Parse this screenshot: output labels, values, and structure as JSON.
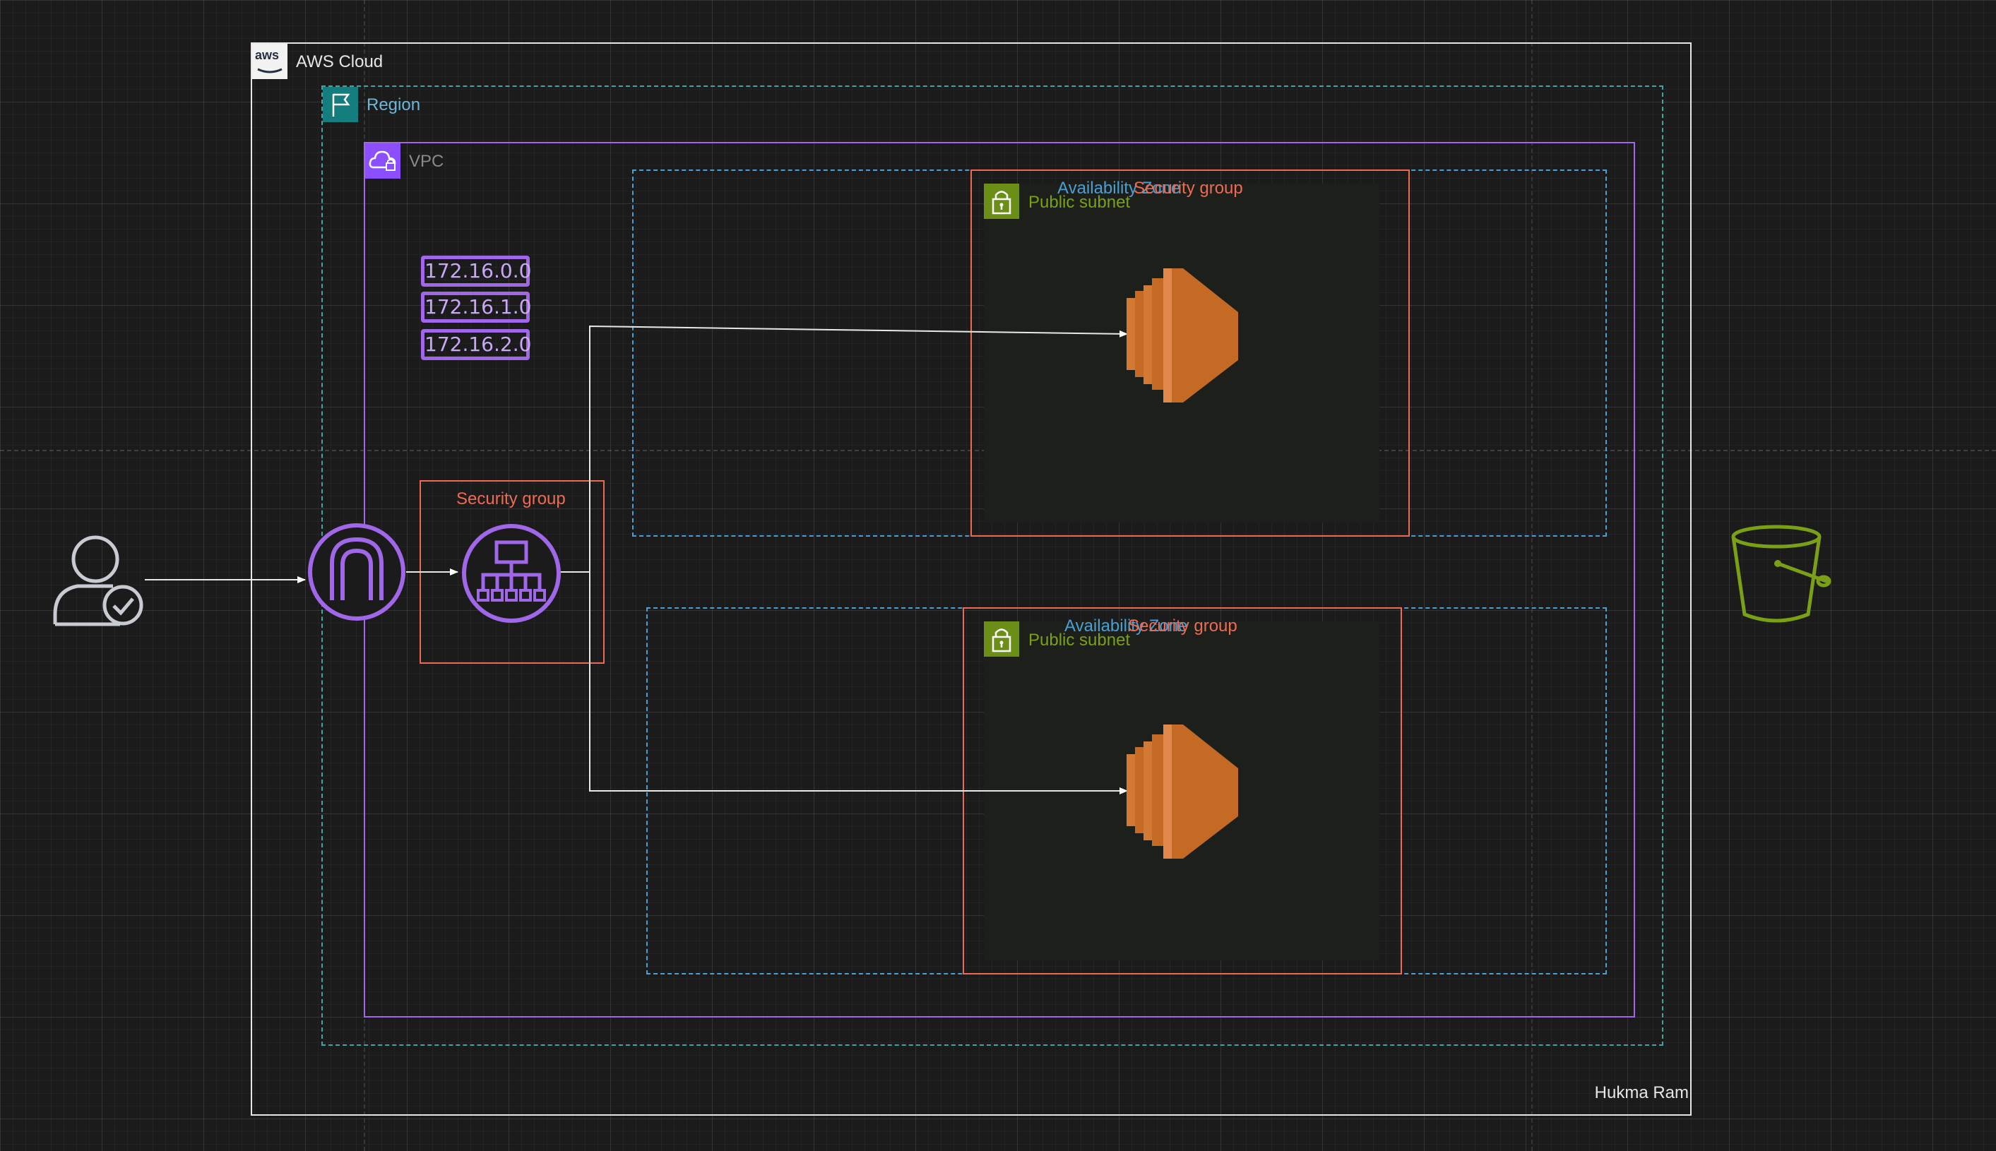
{
  "diagram": {
    "aws_cloud": {
      "label": "AWS Cloud",
      "logo_text": "aws"
    },
    "region": {
      "label": "Region"
    },
    "vpc": {
      "label": "VPC"
    },
    "route_cidrs": [
      "172.16.0.0",
      "172.16.1.0",
      "172.16.2.0"
    ],
    "alb_security_group": {
      "label": "Security group"
    },
    "zone_top": {
      "availability_zone_label": "Availability Zone",
      "security_group_label": "Security group",
      "subnet_label": "Public subnet"
    },
    "zone_bottom": {
      "availability_zone_label": "Availability Zone",
      "security_group_label": "Security group",
      "subnet_label": "Public subnet"
    },
    "author": "Hukma Ram",
    "icons": {
      "user": "authenticated-user-icon",
      "gateway": "internet-gateway-icon",
      "load_balancer": "application-load-balancer-icon",
      "instance": "ec2-instance-icon",
      "bucket": "s3-bucket-icon",
      "region_flag": "region-flag-icon",
      "vpc_cloud": "vpc-cloud-lock-icon",
      "subnet_lock": "subnet-lock-icon"
    },
    "colors": {
      "aws_cloud_border": "#e6e6e6",
      "region": "#3aa6a6",
      "vpc": "#a067e8",
      "security_group": "#f06a53",
      "availability_zone": "#4a9fd4",
      "public_subnet": "#7aa116",
      "ec2": "#c46a25",
      "s3": "#7aa116"
    }
  }
}
